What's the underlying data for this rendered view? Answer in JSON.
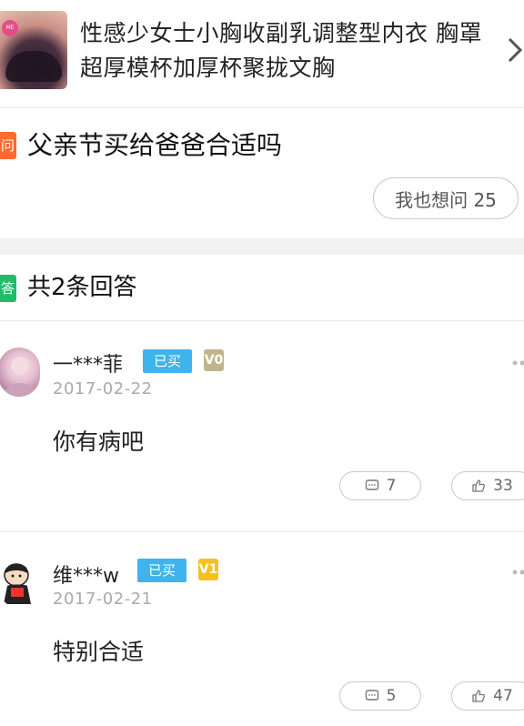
{
  "product": {
    "title": "性感少女士小胸收副乳调整型内衣 胸罩超厚模杯加厚杯聚拢文胸",
    "thumb_tag": "ME"
  },
  "question": {
    "badge": "问",
    "text": "父亲节买给爸爸合适吗",
    "ask_button": "我也想问 25"
  },
  "answers_header": {
    "badge": "答",
    "count_text": "共2条回答"
  },
  "answers": [
    {
      "username": "一***菲",
      "bought_label": "已买",
      "vip_label": "V0",
      "date": "2017-02-22",
      "content": "你有病吧",
      "comment_count": "7",
      "like_count": "33"
    },
    {
      "username": "维***w",
      "bought_label": "已买",
      "vip_label": "V1",
      "date": "2017-02-21",
      "content": "特别合适",
      "comment_count": "5",
      "like_count": "47"
    }
  ],
  "colors": {
    "question_badge": "#ff6a2d",
    "answer_badge": "#22bb6a",
    "bought_badge": "#3fb4ec",
    "vip0": "#bfb58a",
    "vip1": "#f6c21a"
  }
}
